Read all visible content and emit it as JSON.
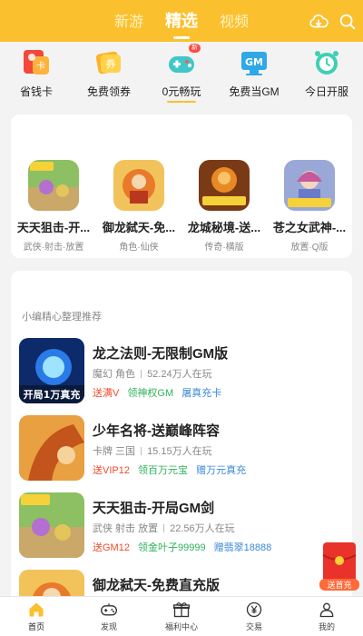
{
  "header": {
    "tabs": [
      {
        "label": "新游",
        "active": false
      },
      {
        "label": "精选",
        "active": true
      },
      {
        "label": "视频",
        "active": false
      }
    ],
    "icons": [
      "cloud-download-icon",
      "search-icon"
    ],
    "colors": {
      "brand": "#fbc02d",
      "accent_red": "#f04a2a",
      "accent_green": "#2fb25a",
      "accent_blue": "#3a8ad8"
    }
  },
  "shortcuts": [
    {
      "label": "省钱卡",
      "icon": "money-card-icon",
      "badge": ""
    },
    {
      "label": "免费领券",
      "icon": "coupon-icon",
      "badge": ""
    },
    {
      "label": "0元畅玩",
      "icon": "gamepad-icon",
      "badge": "新"
    },
    {
      "label": "免费当GM",
      "icon": "gm-icon",
      "badge": "GM"
    },
    {
      "label": "今日开服",
      "icon": "alarm-clock-icon",
      "badge": ""
    }
  ],
  "featured": [
    {
      "name": "天天狙击-开...",
      "tags": "武侠·射击·放置"
    },
    {
      "name": "御龙弑天-免...",
      "tags": "角色·仙侠"
    },
    {
      "name": "龙城秘境-送...",
      "tags": "传奇·横版"
    },
    {
      "name": "苍之女武神-...",
      "tags": "放置·Q版"
    }
  ],
  "recommend": {
    "title": "小编精心整理推荐",
    "items": [
      {
        "name": "龙之法则-无限制GM版",
        "genre": "魔幻 角色",
        "players": "52.24万人在玩",
        "promos": [
          {
            "text": "送满V",
            "color": "red"
          },
          {
            "text": "领神权GM",
            "color": "green"
          },
          {
            "text": "屠真充卡",
            "color": "blue"
          }
        ],
        "thumb_text": "开局1万真充"
      },
      {
        "name": "少年名将-送巅峰阵容",
        "genre": "卡牌 三国",
        "players": "15.15万人在玩",
        "promos": [
          {
            "text": "送VIP12",
            "color": "red"
          },
          {
            "text": "领百万元宝",
            "color": "green"
          },
          {
            "text": "赠万元真充",
            "color": "blue"
          }
        ],
        "thumb_text": ""
      },
      {
        "name": "天天狙击-开局GM剑",
        "genre": "武侠 射击 放置",
        "players": "22.56万人在玩",
        "promos": [
          {
            "text": "送GM12",
            "color": "red"
          },
          {
            "text": "领金叶子99999",
            "color": "green"
          },
          {
            "text": "赠翡翠18888",
            "color": "blue"
          }
        ],
        "thumb_text": ""
      },
      {
        "name": "御龙弑天-免费直充版",
        "genre": "",
        "players": "",
        "promos": [],
        "thumb_text": ""
      }
    ]
  },
  "float_packet": {
    "label": "送首充"
  },
  "bottom_nav": [
    {
      "label": "首页",
      "icon": "home-icon",
      "active": true
    },
    {
      "label": "发现",
      "icon": "gamepad-icon",
      "active": false
    },
    {
      "label": "福利中心",
      "icon": "gift-icon",
      "active": false
    },
    {
      "label": "交易",
      "icon": "yen-coin-icon",
      "active": false
    },
    {
      "label": "我的",
      "icon": "user-icon",
      "active": false
    }
  ]
}
